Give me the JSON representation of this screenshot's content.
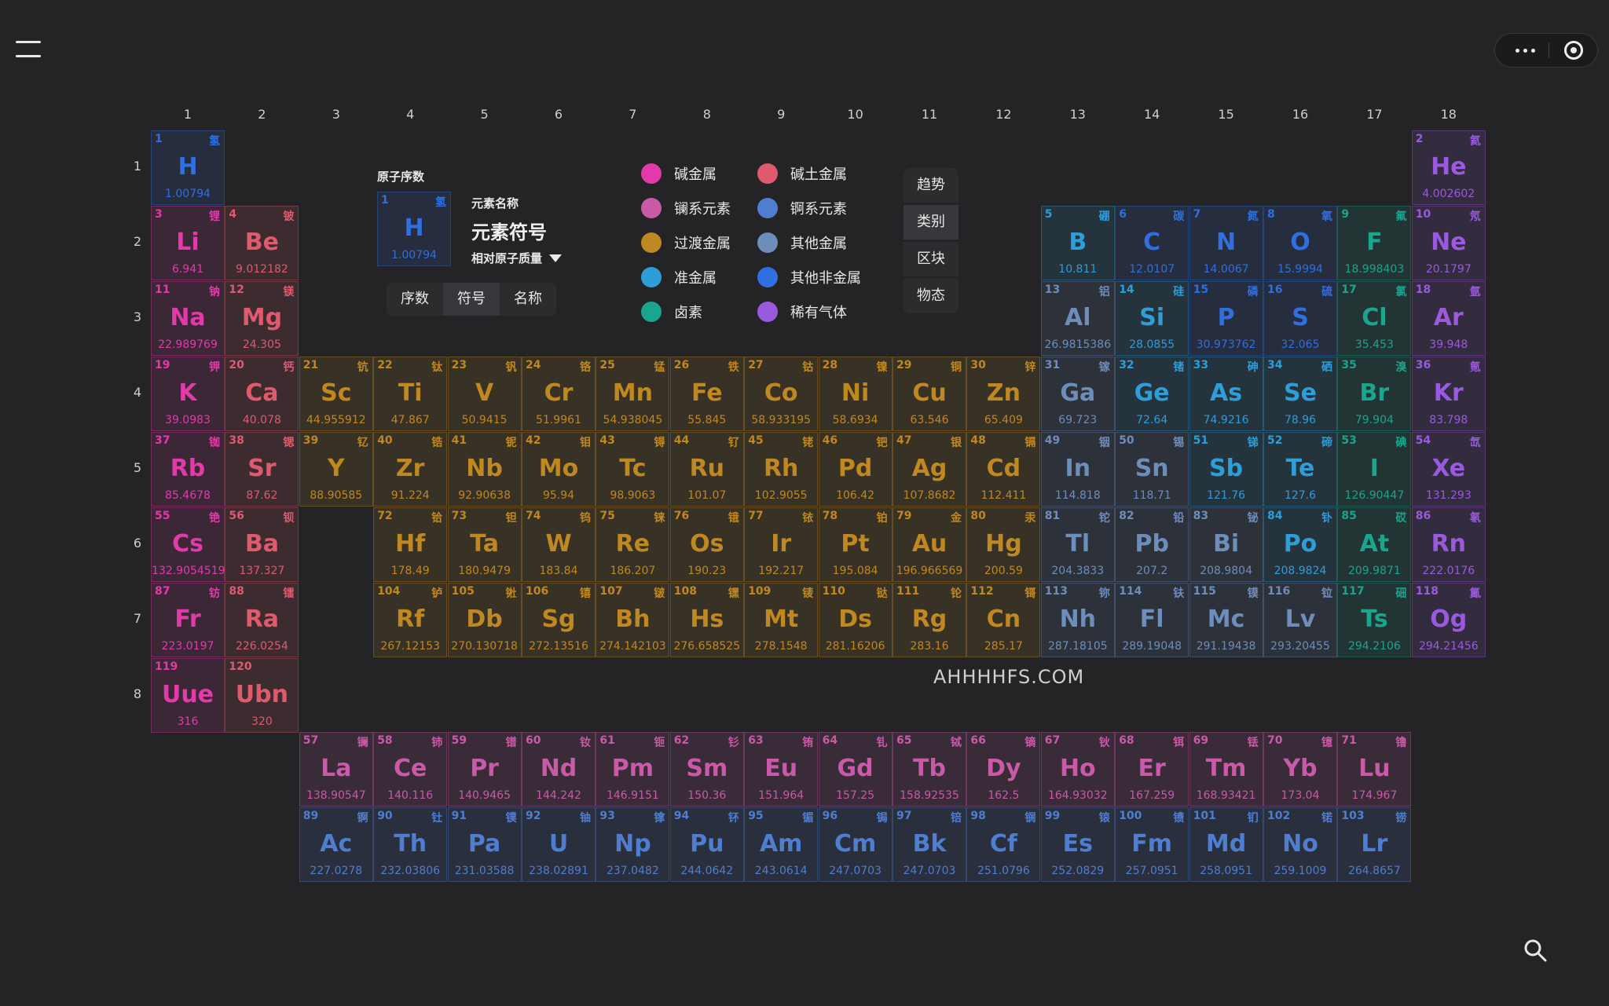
{
  "colors": {
    "alkali": "#e23aa8",
    "alkaline": "#e05a6e",
    "lanthanide": "#c85aa8",
    "actinide": "#4f7ed0",
    "transition": "#c08820",
    "post": "#6d8dba",
    "metalloid": "#2e9dd8",
    "nonmetal": "#2f6fe0",
    "halogen": "#1aa58e",
    "noble": "#9a5ae0"
  },
  "header": {
    "menu_icon": "hamburger-icon",
    "more_icon": "ellipsis-icon",
    "target_icon": "target-icon"
  },
  "groups": [
    "1",
    "2",
    "3",
    "4",
    "5",
    "6",
    "7",
    "8",
    "9",
    "10",
    "11",
    "12",
    "13",
    "14",
    "15",
    "16",
    "17",
    "18"
  ],
  "periods": [
    "1",
    "2",
    "3",
    "4",
    "5",
    "6",
    "7",
    "8"
  ],
  "key": {
    "title": "原子序数",
    "name_label": "元素名称",
    "symbol_label": "元素符号",
    "mass_label": "相对原子质量",
    "sample": {
      "n": "1",
      "cn": "氢",
      "sym": "H",
      "m": "1.00794"
    }
  },
  "display_tabs": [
    {
      "label": "序数",
      "selected": false
    },
    {
      "label": "符号",
      "selected": true
    },
    {
      "label": "名称",
      "selected": false
    }
  ],
  "legend": [
    {
      "label": "碱金属",
      "cat": "alkali"
    },
    {
      "label": "碱土金属",
      "cat": "alkaline"
    },
    {
      "label": "镧系元素",
      "cat": "lanthanide"
    },
    {
      "label": "锕系元素",
      "cat": "actinide"
    },
    {
      "label": "过渡金属",
      "cat": "transition"
    },
    {
      "label": "其他金属",
      "cat": "post"
    },
    {
      "label": "准金属",
      "cat": "metalloid"
    },
    {
      "label": "其他非金属",
      "cat": "nonmetal"
    },
    {
      "label": "卤素",
      "cat": "halogen"
    },
    {
      "label": "稀有气体",
      "cat": "noble"
    }
  ],
  "side_buttons": [
    {
      "label": "趋势",
      "selected": false
    },
    {
      "label": "类别",
      "selected": true
    },
    {
      "label": "区块",
      "selected": false
    },
    {
      "label": "物态",
      "selected": false
    }
  ],
  "watermark": "AHHHHFS.COM",
  "search_icon": "search-icon",
  "elements": [
    {
      "n": "1",
      "cn": "氢",
      "sym": "H",
      "m": "1.00794",
      "g": 1,
      "p": 1,
      "cat": "nonmetal"
    },
    {
      "n": "2",
      "cn": "氦",
      "sym": "He",
      "m": "4.002602",
      "g": 18,
      "p": 1,
      "cat": "noble"
    },
    {
      "n": "3",
      "cn": "锂",
      "sym": "Li",
      "m": "6.941",
      "g": 1,
      "p": 2,
      "cat": "alkali"
    },
    {
      "n": "4",
      "cn": "铍",
      "sym": "Be",
      "m": "9.012182",
      "g": 2,
      "p": 2,
      "cat": "alkaline"
    },
    {
      "n": "5",
      "cn": "硼",
      "sym": "B",
      "m": "10.811",
      "g": 13,
      "p": 2,
      "cat": "metalloid"
    },
    {
      "n": "6",
      "cn": "碳",
      "sym": "C",
      "m": "12.0107",
      "g": 14,
      "p": 2,
      "cat": "nonmetal"
    },
    {
      "n": "7",
      "cn": "氮",
      "sym": "N",
      "m": "14.0067",
      "g": 15,
      "p": 2,
      "cat": "nonmetal"
    },
    {
      "n": "8",
      "cn": "氧",
      "sym": "O",
      "m": "15.9994",
      "g": 16,
      "p": 2,
      "cat": "nonmetal"
    },
    {
      "n": "9",
      "cn": "氟",
      "sym": "F",
      "m": "18.998403",
      "g": 17,
      "p": 2,
      "cat": "halogen"
    },
    {
      "n": "10",
      "cn": "氖",
      "sym": "Ne",
      "m": "20.1797",
      "g": 18,
      "p": 2,
      "cat": "noble"
    },
    {
      "n": "11",
      "cn": "钠",
      "sym": "Na",
      "m": "22.989769",
      "g": 1,
      "p": 3,
      "cat": "alkali"
    },
    {
      "n": "12",
      "cn": "镁",
      "sym": "Mg",
      "m": "24.305",
      "g": 2,
      "p": 3,
      "cat": "alkaline"
    },
    {
      "n": "13",
      "cn": "铝",
      "sym": "Al",
      "m": "26.9815386",
      "g": 13,
      "p": 3,
      "cat": "post"
    },
    {
      "n": "14",
      "cn": "硅",
      "sym": "Si",
      "m": "28.0855",
      "g": 14,
      "p": 3,
      "cat": "metalloid"
    },
    {
      "n": "15",
      "cn": "磷",
      "sym": "P",
      "m": "30.973762",
      "g": 15,
      "p": 3,
      "cat": "nonmetal"
    },
    {
      "n": "16",
      "cn": "硫",
      "sym": "S",
      "m": "32.065",
      "g": 16,
      "p": 3,
      "cat": "nonmetal"
    },
    {
      "n": "17",
      "cn": "氯",
      "sym": "Cl",
      "m": "35.453",
      "g": 17,
      "p": 3,
      "cat": "halogen"
    },
    {
      "n": "18",
      "cn": "氩",
      "sym": "Ar",
      "m": "39.948",
      "g": 18,
      "p": 3,
      "cat": "noble"
    },
    {
      "n": "19",
      "cn": "钾",
      "sym": "K",
      "m": "39.0983",
      "g": 1,
      "p": 4,
      "cat": "alkali"
    },
    {
      "n": "20",
      "cn": "钙",
      "sym": "Ca",
      "m": "40.078",
      "g": 2,
      "p": 4,
      "cat": "alkaline"
    },
    {
      "n": "21",
      "cn": "钪",
      "sym": "Sc",
      "m": "44.955912",
      "g": 3,
      "p": 4,
      "cat": "transition"
    },
    {
      "n": "22",
      "cn": "钛",
      "sym": "Ti",
      "m": "47.867",
      "g": 4,
      "p": 4,
      "cat": "transition"
    },
    {
      "n": "23",
      "cn": "钒",
      "sym": "V",
      "m": "50.9415",
      "g": 5,
      "p": 4,
      "cat": "transition"
    },
    {
      "n": "24",
      "cn": "铬",
      "sym": "Cr",
      "m": "51.9961",
      "g": 6,
      "p": 4,
      "cat": "transition"
    },
    {
      "n": "25",
      "cn": "锰",
      "sym": "Mn",
      "m": "54.938045",
      "g": 7,
      "p": 4,
      "cat": "transition"
    },
    {
      "n": "26",
      "cn": "铁",
      "sym": "Fe",
      "m": "55.845",
      "g": 8,
      "p": 4,
      "cat": "transition"
    },
    {
      "n": "27",
      "cn": "钴",
      "sym": "Co",
      "m": "58.933195",
      "g": 9,
      "p": 4,
      "cat": "transition"
    },
    {
      "n": "28",
      "cn": "镍",
      "sym": "Ni",
      "m": "58.6934",
      "g": 10,
      "p": 4,
      "cat": "transition"
    },
    {
      "n": "29",
      "cn": "铜",
      "sym": "Cu",
      "m": "63.546",
      "g": 11,
      "p": 4,
      "cat": "transition"
    },
    {
      "n": "30",
      "cn": "锌",
      "sym": "Zn",
      "m": "65.409",
      "g": 12,
      "p": 4,
      "cat": "transition"
    },
    {
      "n": "31",
      "cn": "镓",
      "sym": "Ga",
      "m": "69.723",
      "g": 13,
      "p": 4,
      "cat": "post"
    },
    {
      "n": "32",
      "cn": "锗",
      "sym": "Ge",
      "m": "72.64",
      "g": 14,
      "p": 4,
      "cat": "metalloid"
    },
    {
      "n": "33",
      "cn": "砷",
      "sym": "As",
      "m": "74.9216",
      "g": 15,
      "p": 4,
      "cat": "metalloid"
    },
    {
      "n": "34",
      "cn": "硒",
      "sym": "Se",
      "m": "78.96",
      "g": 16,
      "p": 4,
      "cat": "metalloid"
    },
    {
      "n": "35",
      "cn": "溴",
      "sym": "Br",
      "m": "79.904",
      "g": 17,
      "p": 4,
      "cat": "halogen"
    },
    {
      "n": "36",
      "cn": "氪",
      "sym": "Kr",
      "m": "83.798",
      "g": 18,
      "p": 4,
      "cat": "noble"
    },
    {
      "n": "37",
      "cn": "铷",
      "sym": "Rb",
      "m": "85.4678",
      "g": 1,
      "p": 5,
      "cat": "alkali"
    },
    {
      "n": "38",
      "cn": "锶",
      "sym": "Sr",
      "m": "87.62",
      "g": 2,
      "p": 5,
      "cat": "alkaline"
    },
    {
      "n": "39",
      "cn": "钇",
      "sym": "Y",
      "m": "88.90585",
      "g": 3,
      "p": 5,
      "cat": "transition"
    },
    {
      "n": "40",
      "cn": "锆",
      "sym": "Zr",
      "m": "91.224",
      "g": 4,
      "p": 5,
      "cat": "transition"
    },
    {
      "n": "41",
      "cn": "铌",
      "sym": "Nb",
      "m": "92.90638",
      "g": 5,
      "p": 5,
      "cat": "transition"
    },
    {
      "n": "42",
      "cn": "钼",
      "sym": "Mo",
      "m": "95.94",
      "g": 6,
      "p": 5,
      "cat": "transition"
    },
    {
      "n": "43",
      "cn": "锝",
      "sym": "Tc",
      "m": "98.9063",
      "g": 7,
      "p": 5,
      "cat": "transition"
    },
    {
      "n": "44",
      "cn": "钌",
      "sym": "Ru",
      "m": "101.07",
      "g": 8,
      "p": 5,
      "cat": "transition"
    },
    {
      "n": "45",
      "cn": "铑",
      "sym": "Rh",
      "m": "102.9055",
      "g": 9,
      "p": 5,
      "cat": "transition"
    },
    {
      "n": "46",
      "cn": "钯",
      "sym": "Pd",
      "m": "106.42",
      "g": 10,
      "p": 5,
      "cat": "transition"
    },
    {
      "n": "47",
      "cn": "银",
      "sym": "Ag",
      "m": "107.8682",
      "g": 11,
      "p": 5,
      "cat": "transition"
    },
    {
      "n": "48",
      "cn": "镉",
      "sym": "Cd",
      "m": "112.411",
      "g": 12,
      "p": 5,
      "cat": "transition"
    },
    {
      "n": "49",
      "cn": "铟",
      "sym": "In",
      "m": "114.818",
      "g": 13,
      "p": 5,
      "cat": "post"
    },
    {
      "n": "50",
      "cn": "锡",
      "sym": "Sn",
      "m": "118.71",
      "g": 14,
      "p": 5,
      "cat": "post"
    },
    {
      "n": "51",
      "cn": "锑",
      "sym": "Sb",
      "m": "121.76",
      "g": 15,
      "p": 5,
      "cat": "metalloid"
    },
    {
      "n": "52",
      "cn": "碲",
      "sym": "Te",
      "m": "127.6",
      "g": 16,
      "p": 5,
      "cat": "metalloid"
    },
    {
      "n": "53",
      "cn": "碘",
      "sym": "I",
      "m": "126.90447",
      "g": 17,
      "p": 5,
      "cat": "halogen"
    },
    {
      "n": "54",
      "cn": "氙",
      "sym": "Xe",
      "m": "131.293",
      "g": 18,
      "p": 5,
      "cat": "noble"
    },
    {
      "n": "55",
      "cn": "铯",
      "sym": "Cs",
      "m": "132.9054519",
      "g": 1,
      "p": 6,
      "cat": "alkali"
    },
    {
      "n": "56",
      "cn": "钡",
      "sym": "Ba",
      "m": "137.327",
      "g": 2,
      "p": 6,
      "cat": "alkaline"
    },
    {
      "n": "72",
      "cn": "铪",
      "sym": "Hf",
      "m": "178.49",
      "g": 4,
      "p": 6,
      "cat": "transition"
    },
    {
      "n": "73",
      "cn": "钽",
      "sym": "Ta",
      "m": "180.9479",
      "g": 5,
      "p": 6,
      "cat": "transition"
    },
    {
      "n": "74",
      "cn": "钨",
      "sym": "W",
      "m": "183.84",
      "g": 6,
      "p": 6,
      "cat": "transition"
    },
    {
      "n": "75",
      "cn": "铼",
      "sym": "Re",
      "m": "186.207",
      "g": 7,
      "p": 6,
      "cat": "transition"
    },
    {
      "n": "76",
      "cn": "锇",
      "sym": "Os",
      "m": "190.23",
      "g": 8,
      "p": 6,
      "cat": "transition"
    },
    {
      "n": "77",
      "cn": "铱",
      "sym": "Ir",
      "m": "192.217",
      "g": 9,
      "p": 6,
      "cat": "transition"
    },
    {
      "n": "78",
      "cn": "铂",
      "sym": "Pt",
      "m": "195.084",
      "g": 10,
      "p": 6,
      "cat": "transition"
    },
    {
      "n": "79",
      "cn": "金",
      "sym": "Au",
      "m": "196.966569",
      "g": 11,
      "p": 6,
      "cat": "transition"
    },
    {
      "n": "80",
      "cn": "汞",
      "sym": "Hg",
      "m": "200.59",
      "g": 12,
      "p": 6,
      "cat": "transition"
    },
    {
      "n": "81",
      "cn": "铊",
      "sym": "Tl",
      "m": "204.3833",
      "g": 13,
      "p": 6,
      "cat": "post"
    },
    {
      "n": "82",
      "cn": "铅",
      "sym": "Pb",
      "m": "207.2",
      "g": 14,
      "p": 6,
      "cat": "post"
    },
    {
      "n": "83",
      "cn": "铋",
      "sym": "Bi",
      "m": "208.9804",
      "g": 15,
      "p": 6,
      "cat": "post"
    },
    {
      "n": "84",
      "cn": "钋",
      "sym": "Po",
      "m": "208.9824",
      "g": 16,
      "p": 6,
      "cat": "metalloid"
    },
    {
      "n": "85",
      "cn": "砹",
      "sym": "At",
      "m": "209.9871",
      "g": 17,
      "p": 6,
      "cat": "halogen"
    },
    {
      "n": "86",
      "cn": "氡",
      "sym": "Rn",
      "m": "222.0176",
      "g": 18,
      "p": 6,
      "cat": "noble"
    },
    {
      "n": "87",
      "cn": "钫",
      "sym": "Fr",
      "m": "223.0197",
      "g": 1,
      "p": 7,
      "cat": "alkali"
    },
    {
      "n": "88",
      "cn": "镭",
      "sym": "Ra",
      "m": "226.0254",
      "g": 2,
      "p": 7,
      "cat": "alkaline"
    },
    {
      "n": "104",
      "cn": "𬬻",
      "sym": "Rf",
      "m": "267.12153",
      "g": 4,
      "p": 7,
      "cat": "transition"
    },
    {
      "n": "105",
      "cn": "𬭊",
      "sym": "Db",
      "m": "270.130718",
      "g": 5,
      "p": 7,
      "cat": "transition"
    },
    {
      "n": "106",
      "cn": "𬭳",
      "sym": "Sg",
      "m": "272.13516",
      "g": 6,
      "p": 7,
      "cat": "transition"
    },
    {
      "n": "107",
      "cn": "𬭛",
      "sym": "Bh",
      "m": "274.142103",
      "g": 7,
      "p": 7,
      "cat": "transition"
    },
    {
      "n": "108",
      "cn": "𬭶",
      "sym": "Hs",
      "m": "276.658525",
      "g": 8,
      "p": 7,
      "cat": "transition"
    },
    {
      "n": "109",
      "cn": "鿏",
      "sym": "Mt",
      "m": "278.1548",
      "g": 9,
      "p": 7,
      "cat": "transition"
    },
    {
      "n": "110",
      "cn": "𫟼",
      "sym": "Ds",
      "m": "281.16206",
      "g": 10,
      "p": 7,
      "cat": "transition"
    },
    {
      "n": "111",
      "cn": "𬬭",
      "sym": "Rg",
      "m": "283.16",
      "g": 11,
      "p": 7,
      "cat": "transition"
    },
    {
      "n": "112",
      "cn": "鿔",
      "sym": "Cn",
      "m": "285.17",
      "g": 12,
      "p": 7,
      "cat": "transition"
    },
    {
      "n": "113",
      "cn": "鿭",
      "sym": "Nh",
      "m": "287.18105",
      "g": 13,
      "p": 7,
      "cat": "post"
    },
    {
      "n": "114",
      "cn": "𫓧",
      "sym": "Fl",
      "m": "289.19048",
      "g": 14,
      "p": 7,
      "cat": "post"
    },
    {
      "n": "115",
      "cn": "镆",
      "sym": "Mc",
      "m": "291.19438",
      "g": 15,
      "p": 7,
      "cat": "post"
    },
    {
      "n": "116",
      "cn": "𫟷",
      "sym": "Lv",
      "m": "293.20455",
      "g": 16,
      "p": 7,
      "cat": "post"
    },
    {
      "n": "117",
      "cn": "鿬",
      "sym": "Ts",
      "m": "294.2106",
      "g": 17,
      "p": 7,
      "cat": "halogen"
    },
    {
      "n": "118",
      "cn": "鿫",
      "sym": "Og",
      "m": "294.21456",
      "g": 18,
      "p": 7,
      "cat": "noble"
    },
    {
      "n": "119",
      "cn": "",
      "sym": "Uue",
      "m": "316",
      "g": 1,
      "p": 8,
      "cat": "alkali"
    },
    {
      "n": "120",
      "cn": "",
      "sym": "Ubn",
      "m": "320",
      "g": 2,
      "p": 8,
      "cat": "alkaline"
    },
    {
      "n": "57",
      "cn": "镧",
      "sym": "La",
      "m": "138.90547",
      "g": 3,
      "p": 9,
      "cat": "lanthanide"
    },
    {
      "n": "58",
      "cn": "铈",
      "sym": "Ce",
      "m": "140.116",
      "g": 4,
      "p": 9,
      "cat": "lanthanide"
    },
    {
      "n": "59",
      "cn": "镨",
      "sym": "Pr",
      "m": "140.9465",
      "g": 5,
      "p": 9,
      "cat": "lanthanide"
    },
    {
      "n": "60",
      "cn": "钕",
      "sym": "Nd",
      "m": "144.242",
      "g": 6,
      "p": 9,
      "cat": "lanthanide"
    },
    {
      "n": "61",
      "cn": "钷",
      "sym": "Pm",
      "m": "146.9151",
      "g": 7,
      "p": 9,
      "cat": "lanthanide"
    },
    {
      "n": "62",
      "cn": "钐",
      "sym": "Sm",
      "m": "150.36",
      "g": 8,
      "p": 9,
      "cat": "lanthanide"
    },
    {
      "n": "63",
      "cn": "铕",
      "sym": "Eu",
      "m": "151.964",
      "g": 9,
      "p": 9,
      "cat": "lanthanide"
    },
    {
      "n": "64",
      "cn": "钆",
      "sym": "Gd",
      "m": "157.25",
      "g": 10,
      "p": 9,
      "cat": "lanthanide"
    },
    {
      "n": "65",
      "cn": "铽",
      "sym": "Tb",
      "m": "158.92535",
      "g": 11,
      "p": 9,
      "cat": "lanthanide"
    },
    {
      "n": "66",
      "cn": "镝",
      "sym": "Dy",
      "m": "162.5",
      "g": 12,
      "p": 9,
      "cat": "lanthanide"
    },
    {
      "n": "67",
      "cn": "钬",
      "sym": "Ho",
      "m": "164.93032",
      "g": 13,
      "p": 9,
      "cat": "lanthanide"
    },
    {
      "n": "68",
      "cn": "铒",
      "sym": "Er",
      "m": "167.259",
      "g": 14,
      "p": 9,
      "cat": "lanthanide"
    },
    {
      "n": "69",
      "cn": "铥",
      "sym": "Tm",
      "m": "168.93421",
      "g": 15,
      "p": 9,
      "cat": "lanthanide"
    },
    {
      "n": "70",
      "cn": "镱",
      "sym": "Yb",
      "m": "173.04",
      "g": 16,
      "p": 9,
      "cat": "lanthanide"
    },
    {
      "n": "71",
      "cn": "镥",
      "sym": "Lu",
      "m": "174.967",
      "g": 17,
      "p": 9,
      "cat": "lanthanide"
    },
    {
      "n": "89",
      "cn": "锕",
      "sym": "Ac",
      "m": "227.0278",
      "g": 3,
      "p": 10,
      "cat": "actinide"
    },
    {
      "n": "90",
      "cn": "钍",
      "sym": "Th",
      "m": "232.03806",
      "g": 4,
      "p": 10,
      "cat": "actinide"
    },
    {
      "n": "91",
      "cn": "镤",
      "sym": "Pa",
      "m": "231.03588",
      "g": 5,
      "p": 10,
      "cat": "actinide"
    },
    {
      "n": "92",
      "cn": "铀",
      "sym": "U",
      "m": "238.02891",
      "g": 6,
      "p": 10,
      "cat": "actinide"
    },
    {
      "n": "93",
      "cn": "镎",
      "sym": "Np",
      "m": "237.0482",
      "g": 7,
      "p": 10,
      "cat": "actinide"
    },
    {
      "n": "94",
      "cn": "钚",
      "sym": "Pu",
      "m": "244.0642",
      "g": 8,
      "p": 10,
      "cat": "actinide"
    },
    {
      "n": "95",
      "cn": "镅",
      "sym": "Am",
      "m": "243.0614",
      "g": 9,
      "p": 10,
      "cat": "actinide"
    },
    {
      "n": "96",
      "cn": "锔",
      "sym": "Cm",
      "m": "247.0703",
      "g": 10,
      "p": 10,
      "cat": "actinide"
    },
    {
      "n": "97",
      "cn": "锫",
      "sym": "Bk",
      "m": "247.0703",
      "g": 11,
      "p": 10,
      "cat": "actinide"
    },
    {
      "n": "98",
      "cn": "锎",
      "sym": "Cf",
      "m": "251.0796",
      "g": 12,
      "p": 10,
      "cat": "actinide"
    },
    {
      "n": "99",
      "cn": "锿",
      "sym": "Es",
      "m": "252.0829",
      "g": 13,
      "p": 10,
      "cat": "actinide"
    },
    {
      "n": "100",
      "cn": "镄",
      "sym": "Fm",
      "m": "257.0951",
      "g": 14,
      "p": 10,
      "cat": "actinide"
    },
    {
      "n": "101",
      "cn": "钔",
      "sym": "Md",
      "m": "258.0951",
      "g": 15,
      "p": 10,
      "cat": "actinide"
    },
    {
      "n": "102",
      "cn": "锘",
      "sym": "No",
      "m": "259.1009",
      "g": 16,
      "p": 10,
      "cat": "actinide"
    },
    {
      "n": "103",
      "cn": "铹",
      "sym": "Lr",
      "m": "264.8657",
      "g": 17,
      "p": 10,
      "cat": "actinide"
    }
  ]
}
